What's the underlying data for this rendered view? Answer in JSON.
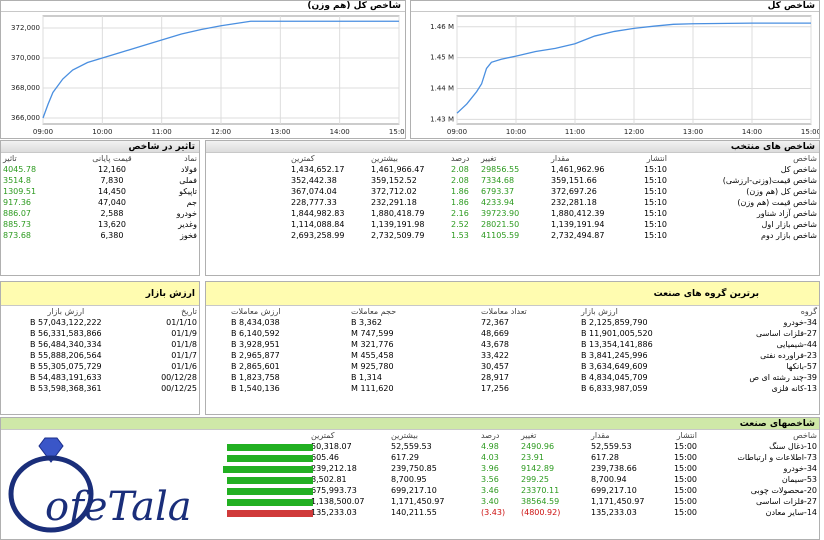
{
  "chart_left": {
    "title": "شاخص کل (هم وزن)",
    "chart_data": {
      "type": "line",
      "x_ticks": [
        "09:00",
        "10:00",
        "11:00",
        "12:00",
        "13:00",
        "14:00",
        "15:00"
      ],
      "y_ticks": [
        "366,000",
        "368,000",
        "370,000",
        "372,000"
      ],
      "ylim": [
        365600,
        372800
      ],
      "x": [
        "09:00",
        "09:05",
        "09:10",
        "09:20",
        "09:30",
        "09:45",
        "10:00",
        "10:20",
        "10:40",
        "11:00",
        "11:20",
        "11:40",
        "12:00",
        "12:20",
        "12:30",
        "13:00",
        "14:00",
        "15:00"
      ],
      "values": [
        366000,
        366900,
        367700,
        368600,
        369200,
        369700,
        370000,
        370400,
        370800,
        371200,
        371600,
        371900,
        372150,
        372350,
        372450,
        372450,
        372450,
        372450
      ],
      "color": "#4a8fe0"
    }
  },
  "chart_right": {
    "title": "شاخص کل",
    "chart_data": {
      "type": "line",
      "x_ticks": [
        "09:00",
        "10:00",
        "11:00",
        "12:00",
        "13:00",
        "14:00",
        "15:00"
      ],
      "y_ticks": [
        "1.43 M",
        "1.44 M",
        "1.45 M",
        "1.46 M"
      ],
      "ylim": [
        1.4285,
        1.4635
      ],
      "x": [
        "09:00",
        "09:10",
        "09:20",
        "09:25",
        "09:30",
        "09:35",
        "09:45",
        "10:00",
        "10:20",
        "10:40",
        "11:00",
        "11:20",
        "11:40",
        "12:00",
        "12:20",
        "12:40",
        "13:00",
        "14:00",
        "15:00"
      ],
      "values": [
        1.432,
        1.435,
        1.439,
        1.4415,
        1.4465,
        1.4485,
        1.4495,
        1.4505,
        1.452,
        1.453,
        1.4545,
        1.457,
        1.4585,
        1.4595,
        1.4602,
        1.4608,
        1.461,
        1.4612,
        1.4612
      ],
      "color": "#4a8fe0"
    }
  },
  "impact": {
    "title": "تاثیر در شاخص",
    "headers": [
      "نماد",
      "قیمت پایانی",
      "تاثیر"
    ],
    "rows": [
      [
        "فولاد",
        "12,160",
        "4045.78"
      ],
      [
        "فملی",
        "7,830",
        "3514.8"
      ],
      [
        "تاپیکو",
        "14,450",
        "1309.51"
      ],
      [
        "جم",
        "47,040",
        "917.36"
      ],
      [
        "خودرو",
        "2,588",
        "886.07"
      ],
      [
        "وغدیر",
        "13,620",
        "885.73"
      ],
      [
        "فخوز",
        "6,380",
        "873.68"
      ]
    ]
  },
  "indices": {
    "title": "شاخص های منتخب",
    "headers": [
      "شاخص",
      "انتشار",
      "مقدار",
      "تغییر",
      "درصد",
      "بیشترین",
      "کمترین"
    ],
    "rows": [
      [
        "شاخص کل",
        "15:10",
        "1,461,962.96",
        "29856.55",
        "2.08",
        "1,461,966.47",
        "1,434,652.17"
      ],
      [
        "شاخص قیمت(وزنی-ارزشی)",
        "15:10",
        "359,151.66",
        "7334.68",
        "2.08",
        "359,152.52",
        "352,442.38"
      ],
      [
        "شاخص کل (هم وزن)",
        "15:10",
        "372,697.26",
        "6793.37",
        "1.86",
        "372,712.02",
        "367,074.04"
      ],
      [
        "شاخص قیمت (هم وزن)",
        "15:10",
        "232,281.18",
        "4233.94",
        "1.86",
        "232,291.18",
        "228,777.33"
      ],
      [
        "شاخص آزاد شناور",
        "15:10",
        "1,880,412.39",
        "39723.90",
        "2.16",
        "1,880,418.79",
        "1,844,982.83"
      ],
      [
        "شاخص بازار اول",
        "15:10",
        "1,139,191.94",
        "28021.50",
        "2.52",
        "1,139,191.98",
        "1,114,088.84"
      ],
      [
        "شاخص بازار دوم",
        "15:10",
        "2,732,494.87",
        "41105.59",
        "1.53",
        "2,732,509.79",
        "2,693,258.99"
      ]
    ]
  },
  "market_value": {
    "title": "ارزش بازار",
    "headers": [
      "تاریخ",
      "ارزش بازار"
    ],
    "rows": [
      [
        "01/1/10",
        "57,043,122,222 B"
      ],
      [
        "01/1/9",
        "56,331,583,866 B"
      ],
      [
        "01/1/8",
        "56,484,340,334 B"
      ],
      [
        "01/1/7",
        "55,888,206,564 B"
      ],
      [
        "01/1/6",
        "55,305,075,729 B"
      ],
      [
        "00/12/28",
        "54,483,191,633 B"
      ],
      [
        "00/12/25",
        "53,598,368,361 B"
      ]
    ]
  },
  "top_groups": {
    "title": "برترین گروه های صنعت",
    "headers": [
      "گروه",
      "ارزش بازار",
      "تعداد معاملات",
      "حجم معاملات",
      "ارزش معاملات"
    ],
    "rows": [
      [
        "34-خودرو",
        "2,125,859,790 B",
        "72,367",
        "3,362 B",
        "8,434,038 B"
      ],
      [
        "27-فلزات اساسی",
        "11,901,005,520 B",
        "48,669",
        "747,599 M",
        "6,140,592 B"
      ],
      [
        "44-شیمیایی",
        "13,354,141,886 B",
        "43,678",
        "321,776 M",
        "3,928,951 B"
      ],
      [
        "23-فراورده نفتی",
        "3,841,245,996 B",
        "33,422",
        "455,458 M",
        "2,965,877 B"
      ],
      [
        "57-بانکها",
        "3,634,649,609 B",
        "30,457",
        "925,780 M",
        "2,865,601 B"
      ],
      [
        "39-چند رشته ای ص",
        "4,834,045,709 B",
        "28,917",
        "1,314 B",
        "1,823,758 B"
      ],
      [
        "13-کانه فلزی",
        "6,833,987,059 B",
        "17,256",
        "111,620 M",
        "1,540,136 B"
      ]
    ]
  },
  "sectors": {
    "title": "شاخصهای صنعت",
    "headers": [
      "شاخص",
      "انتشار",
      "مقدار",
      "تغییر",
      "درصد",
      "بیشترین",
      "کمترین"
    ],
    "rows": [
      [
        "10-ذغال سنگ",
        "15:00",
        "52,559.53",
        "2490.96",
        "4.98",
        "52,559.53",
        "50,318.07"
      ],
      [
        "73-اطلاعات و ارتباطات",
        "15:00",
        "617.28",
        "23.91",
        "4.03",
        "617.29",
        "605.46"
      ],
      [
        "34-خودرو",
        "15:00",
        "239,738.66",
        "9142.89",
        "3.96",
        "239,750.85",
        "239,212.18"
      ],
      [
        "53-سیمان",
        "15:00",
        "8,700.94",
        "299.25",
        "3.56",
        "8,700.95",
        "8,502.81"
      ],
      [
        "20-محصولات چوبی",
        "15:00",
        "699,217.10",
        "23370.11",
        "3.46",
        "699,217.10",
        "675,993.73"
      ],
      [
        "27-فلزات اساسی",
        "15:00",
        "1,171,450.97",
        "38564.59",
        "3.40",
        "1,171,450.97",
        "1,138,500.07"
      ],
      [
        "14-سایر معادن",
        "15:00",
        "135,233.03",
        "(4800.92)",
        "(3.43)",
        "140,211.55",
        "135,233.03"
      ]
    ],
    "bars": [
      0.86,
      0.86,
      0.9,
      0.86,
      0.86,
      0.86,
      0.86
    ],
    "bar_colors": [
      "#22b022",
      "#22b022",
      "#22b022",
      "#22b022",
      "#22b022",
      "#22b022",
      "#d03a3a"
    ]
  },
  "logo_text": "ofeTala"
}
